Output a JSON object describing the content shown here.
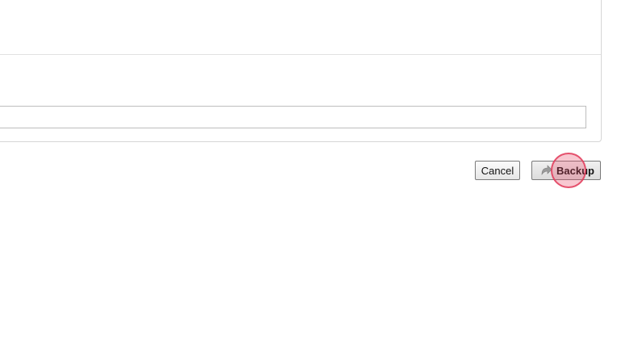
{
  "form": {
    "text_field_value": "",
    "text_field_placeholder": ""
  },
  "actions": {
    "cancel_label": "Cancel",
    "backup_label": "Backup",
    "backup_icon": "redo-arrow-icon"
  },
  "colors": {
    "click_indicator": "#e23c5c",
    "border": "#d6d6d6"
  }
}
